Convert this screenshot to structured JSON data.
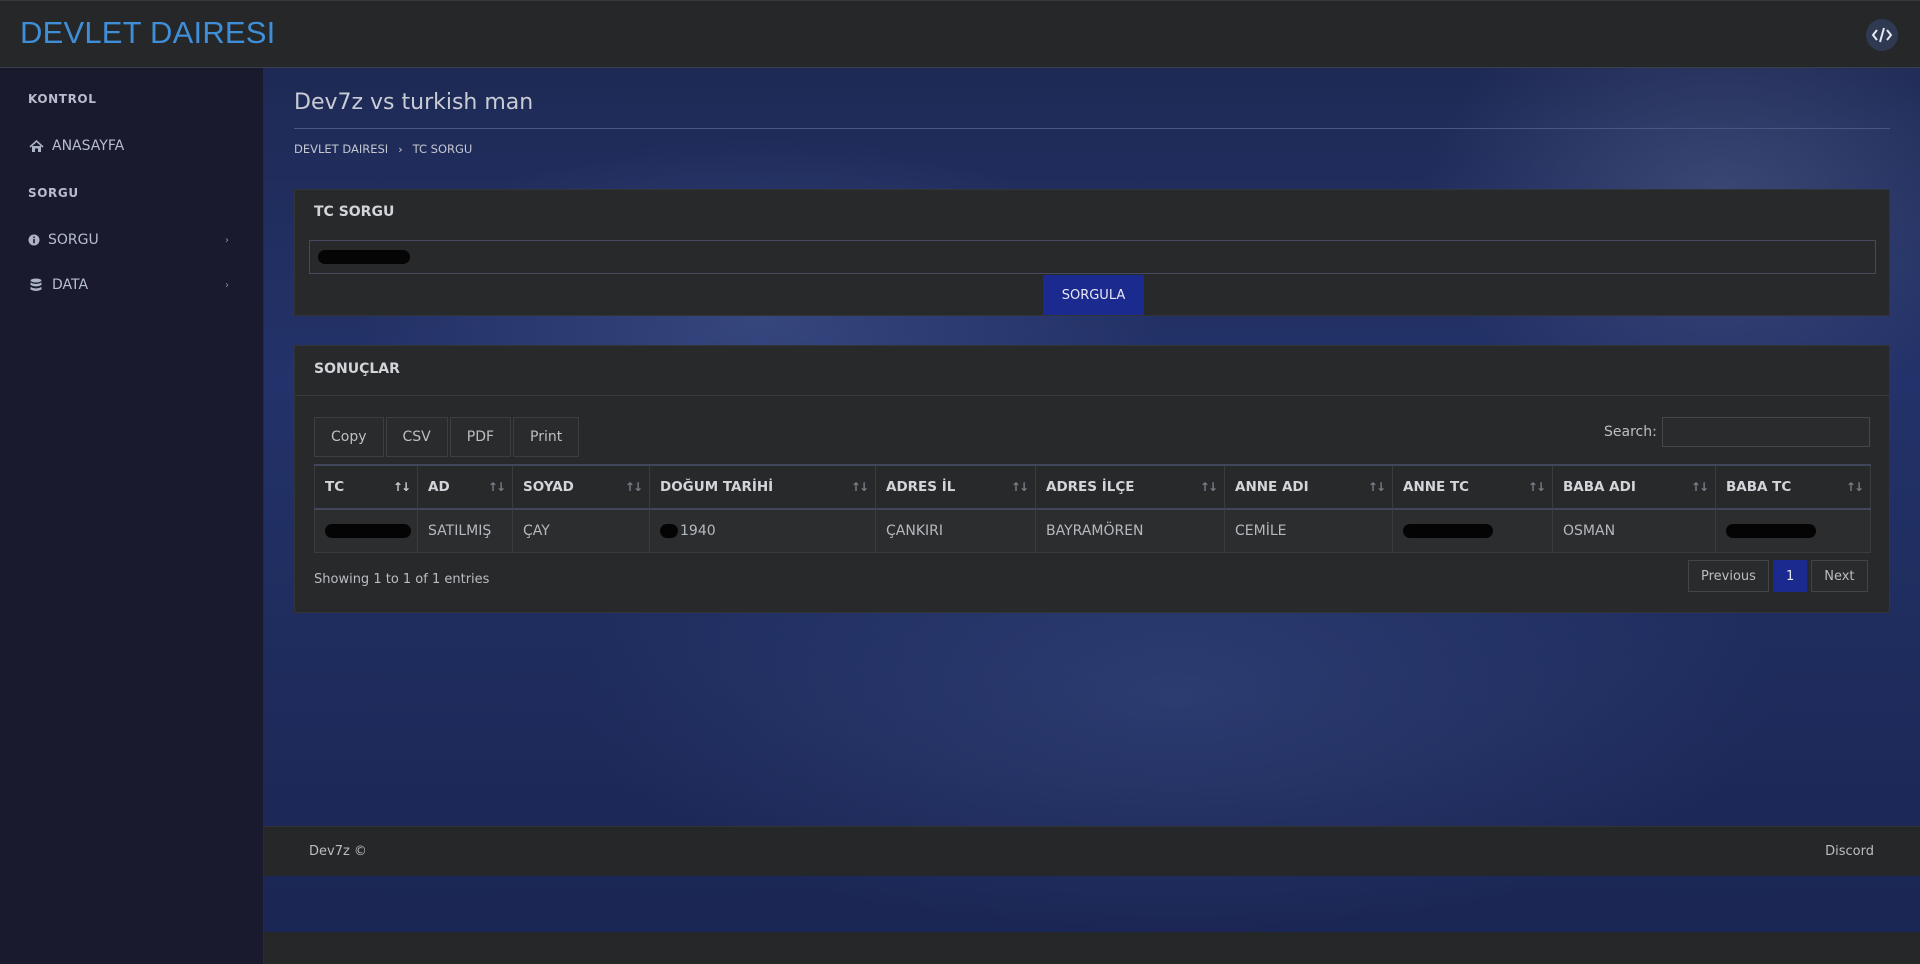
{
  "header": {
    "brand": "DEVLET DAIRESI",
    "logo_icon": "code-logo-icon"
  },
  "sidebar": {
    "sections": [
      {
        "label": "KONTROL"
      },
      {
        "label": "SORGU"
      }
    ],
    "items": [
      {
        "label": "ANASAYFA",
        "icon": "home-icon"
      },
      {
        "label": "SORGU",
        "icon": "info-icon"
      },
      {
        "label": "DATA",
        "icon": "database-icon"
      }
    ]
  },
  "page": {
    "title": "Dev7z vs turkish man",
    "breadcrumb": [
      "DEVLET DAIRESI",
      "TC SORGU"
    ]
  },
  "query_card": {
    "title": "TC SORGU",
    "submit_label": "SORGULA"
  },
  "results_card": {
    "title": "SONUÇLAR",
    "export_buttons": [
      "Copy",
      "CSV",
      "PDF",
      "Print"
    ],
    "search_label": "Search:",
    "columns": [
      "TC",
      "AD",
      "SOYAD",
      "DOĞUM TARİHİ",
      "ADRES İL",
      "ADRES İLÇE",
      "ANNE ADI",
      "ANNE TC",
      "BABA ADI",
      "BABA TC"
    ],
    "rows": [
      {
        "ad": "SATILMIŞ",
        "soyad": "ÇAY",
        "dogum_tarihi": "1940",
        "adres_il": "ÇANKIRI",
        "adres_ilce": "BAYRAMÖREN",
        "anne_adi": "CEMİLE",
        "baba_adi": "OSMAN"
      }
    ],
    "info": "Showing 1 to 1 of 1 entries",
    "pagination": {
      "previous": "Previous",
      "current": "1",
      "next": "Next"
    }
  },
  "footer": {
    "left": "Dev7z ©",
    "right": "Discord"
  },
  "colors": {
    "brand": "#3e8ed8",
    "primary_button": "#1b2a8f",
    "sidebar_bg": "#191a2e"
  }
}
